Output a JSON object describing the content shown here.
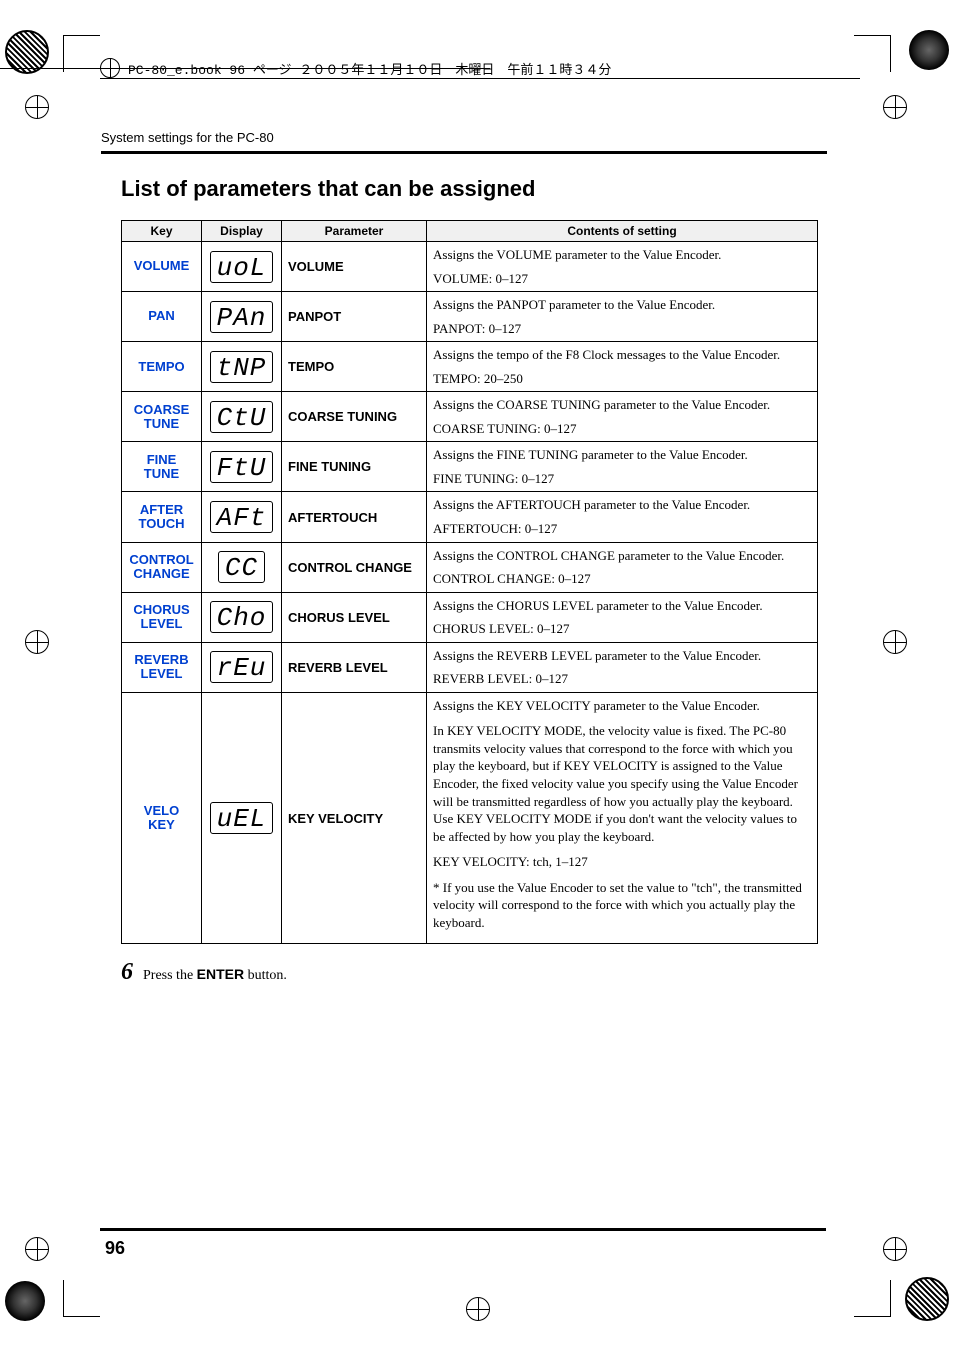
{
  "header_note": "PC-80_e.book 96 ページ ２００５年１１月１０日　木曜日　午前１１時３４分",
  "section_path": "System settings for the PC-80",
  "heading": "List of parameters that can be assigned",
  "columns": {
    "key": "Key",
    "display": "Display",
    "parameter": "Parameter",
    "contents": "Contents of setting"
  },
  "rows": [
    {
      "key": "VOLUME",
      "display": "uoL",
      "parameter": "VOLUME",
      "desc": "Assigns the VOLUME parameter to the Value Encoder.",
      "range": "VOLUME: 0–127"
    },
    {
      "key": "PAN",
      "display": "PAn",
      "parameter": "PANPOT",
      "desc": "Assigns the PANPOT parameter to the Value Encoder.",
      "range": "PANPOT: 0–127"
    },
    {
      "key": "TEMPO",
      "display": "tNP",
      "parameter": "TEMPO",
      "desc": "Assigns the tempo of the F8 Clock messages to the Value Encoder.",
      "range": "TEMPO: 20–250"
    },
    {
      "key": "COARSE\nTUNE",
      "display": "CtU",
      "parameter": "COARSE TUNING",
      "desc": "Assigns the COARSE TUNING parameter to the Value Encoder.",
      "range": "COARSE TUNING: 0–127"
    },
    {
      "key": "FINE\nTUNE",
      "display": "FtU",
      "parameter": "FINE TUNING",
      "desc": "Assigns the FINE TUNING parameter to the Value Encoder.",
      "range": "FINE TUNING: 0–127"
    },
    {
      "key": "AFTER\nTOUCH",
      "display": "AFt",
      "parameter": "AFTERTOUCH",
      "desc": "Assigns the AFTERTOUCH parameter to the Value Encoder.",
      "range": "AFTERTOUCH: 0–127"
    },
    {
      "key": "CONTROL\nCHANGE",
      "display": "CC",
      "parameter": "CONTROL CHANGE",
      "desc": "Assigns the CONTROL CHANGE parameter to the Value Encoder.",
      "range": "CONTROL CHANGE: 0–127"
    },
    {
      "key": "CHORUS\nLEVEL",
      "display": "Cho",
      "parameter": "CHORUS LEVEL",
      "desc": "Assigns the CHORUS LEVEL parameter to the Value Encoder.",
      "range": "CHORUS LEVEL: 0–127"
    },
    {
      "key": "REVERB\nLEVEL",
      "display": "rEu",
      "parameter": "REVERB LEVEL",
      "desc": "Assigns the REVERB LEVEL parameter to the Value Encoder.",
      "range": "REVERB LEVEL: 0–127"
    }
  ],
  "velo": {
    "key": "VELO\nKEY",
    "display": "uEL",
    "parameter": "KEY VELOCITY",
    "desc_line": "Assigns the KEY VELOCITY parameter to the Value Encoder.",
    "para": "In KEY VELOCITY MODE, the velocity value is fixed.\nThe PC-80 transmits velocity values that correspond to the force with which you play the keyboard, but if KEY VELOCITY is assigned to the Value Encoder, the fixed velocity value you specify using the Value Encoder will be transmitted regardless of how you actually play the keyboard. Use KEY VELOCITY MODE if you don't want the velocity values to be affected by how you play the keyboard.",
    "range": "KEY VELOCITY: tch, 1–127",
    "note": "* If you use the Value Encoder to set the value to \"tch\", the transmitted velocity will correspond to the force with which you actually play the keyboard."
  },
  "step": {
    "num": "6",
    "pre": "Press the ",
    "btn": "ENTER",
    "post": " button."
  },
  "page_number": "96"
}
